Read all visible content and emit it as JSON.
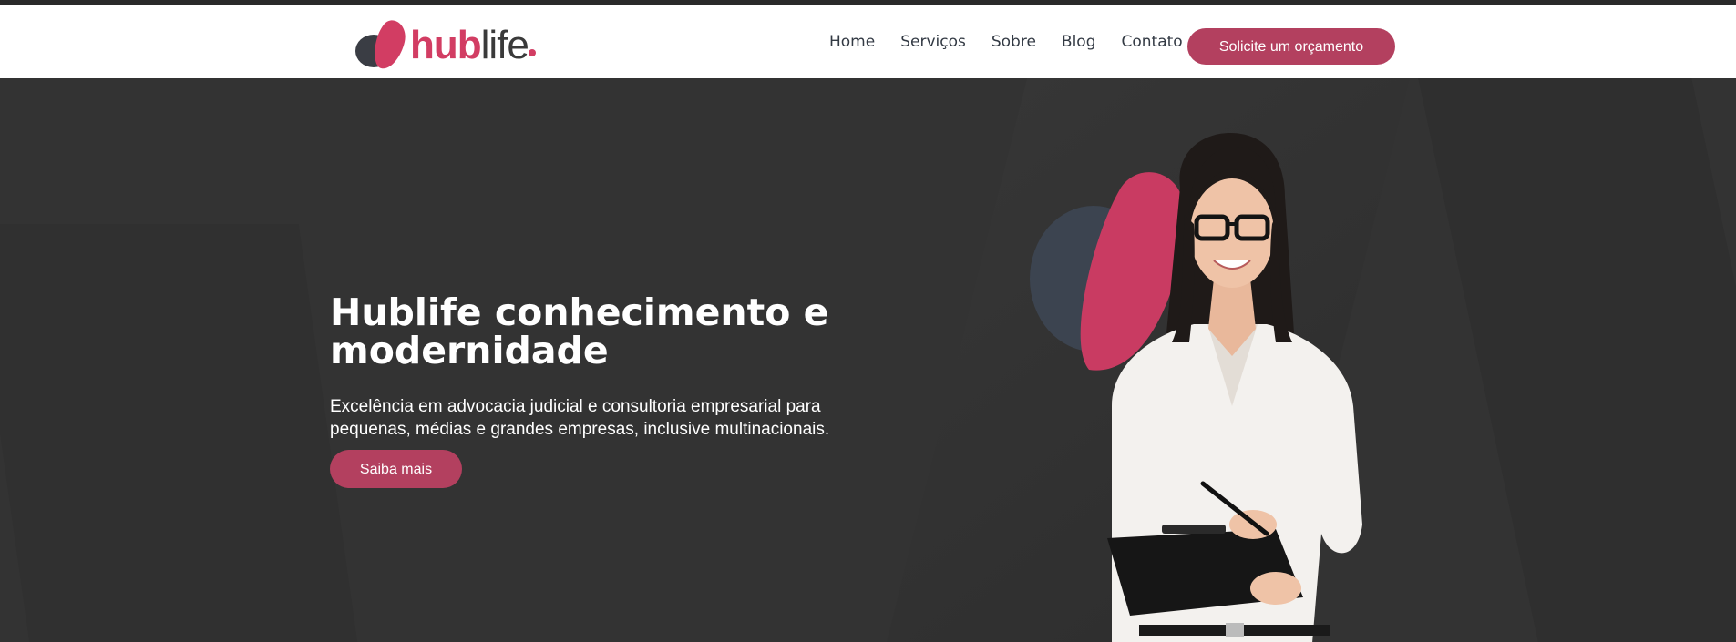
{
  "brand": {
    "name_part1": "hub",
    "name_part2": "life",
    "accent_color": "#d23d63",
    "dark_color": "#3a3a3a"
  },
  "nav": {
    "items": [
      {
        "label": "Home"
      },
      {
        "label": "Serviços"
      },
      {
        "label": "Sobre"
      },
      {
        "label": "Blog"
      },
      {
        "label": "Contato"
      }
    ],
    "cta_label": "Solicite um orçamento",
    "cta_color": "#b3405f"
  },
  "hero": {
    "title": "Hublife conhecimento e modernidade",
    "subtitle": "Excelência em advocacia judicial e consultoria empresarial para pequenas, médias e grandes empresas, inclusive multinacionais.",
    "button_label": "Saiba mais",
    "background_color": "#333333"
  }
}
